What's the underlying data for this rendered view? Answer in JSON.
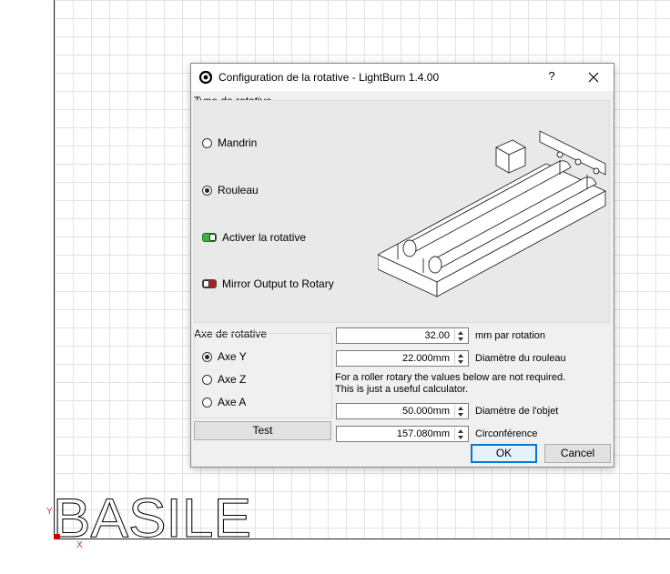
{
  "canvas": {
    "axis_y_label": "Y",
    "axis_x_label": "X",
    "text_object": "BASILE"
  },
  "dialog": {
    "title": "Configuration de la rotative - LightBurn 1.4.00",
    "help_label": "?",
    "rotary_type": {
      "group_label": "Type de rotative",
      "options": [
        {
          "label": "Mandrin",
          "selected": false
        },
        {
          "label": "Rouleau",
          "selected": true
        }
      ],
      "enable_label": "Activer la rotative",
      "enable_on": true,
      "mirror_label": "Mirror Output to Rotary",
      "mirror_on": false
    },
    "rotary_axis": {
      "group_label": "Axe de rotative",
      "options": [
        {
          "label": "Axe Y",
          "selected": true
        },
        {
          "label": "Axe Z",
          "selected": false
        },
        {
          "label": "Axe A",
          "selected": false
        }
      ]
    },
    "test_label": "Test",
    "fields": {
      "mm_per_rotation": {
        "value": "32.00",
        "label": "mm par rotation"
      },
      "roller_diameter": {
        "value": "22.000mm",
        "label": "Diamètre du rouleau"
      },
      "note_line1": "For a roller rotary the values below are not required.",
      "note_line2": "This is just a useful calculator.",
      "object_diameter": {
        "value": "50.000mm",
        "label": "Diamètre de l'objet"
      },
      "circumference": {
        "value": "157.080mm",
        "label": "Circonférence"
      }
    },
    "ok_label": "OK",
    "cancel_label": "Cancel"
  },
  "colors": {
    "enable_toggle": "#3cb043",
    "mirror_toggle": "#b02020",
    "ok_border": "#0078d7"
  }
}
